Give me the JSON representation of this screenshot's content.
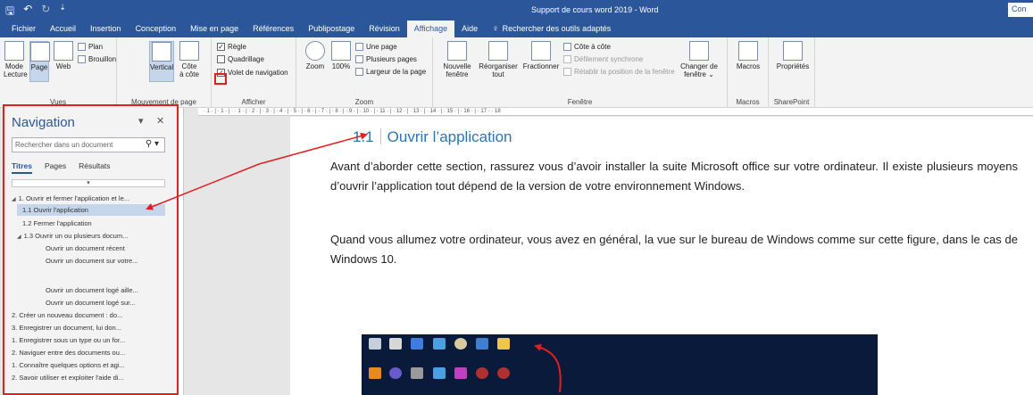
{
  "titlebar": {
    "doc_title": "Support de cours word 2019  -  Word",
    "account_btn": "Con"
  },
  "tabs": [
    "Fichier",
    "Accueil",
    "Insertion",
    "Conception",
    "Mise en page",
    "Références",
    "Publipostage",
    "Révision",
    "Affichage",
    "Aide"
  ],
  "tell_me": "Rechercher des outils adaptés",
  "ribbon": {
    "vues": {
      "label": "Vues",
      "mode_lecture": "Mode\nLecture",
      "page": "Page",
      "web": "Web",
      "plan": "Plan",
      "brouillon": "Brouillon"
    },
    "mouvement": {
      "label": "Mouvement de page",
      "vertical": "Vertical",
      "cote": "Côte\nà côte"
    },
    "afficher": {
      "label": "Afficher",
      "regle": "Règle",
      "quadrillage": "Quadrillage",
      "volet": "Volet de navigation",
      "regle_checked": "✓",
      "volet_checked": "✓"
    },
    "zoom": {
      "label": "Zoom",
      "zoom": "Zoom",
      "pct": "100%",
      "une_page": "Une page",
      "plusieurs": "Plusieurs pages",
      "largeur": "Largeur de la page"
    },
    "fenetre": {
      "label": "Fenêtre",
      "nouvelle": "Nouvelle\nfenêtre",
      "reorganiser": "Réorganiser\ntout",
      "fractionner": "Fractionner",
      "cote_a_cote": "Côte à côte",
      "defilement": "Défilement synchrone",
      "retablir": "Rétablir la position de la fenêtre",
      "changer": "Changer de\nfenêtre ⌄"
    },
    "macros": {
      "label": "Macros",
      "btn": "Macros"
    },
    "sharepoint": {
      "label": "SharePoint",
      "btn": "Propriétés"
    }
  },
  "navigation": {
    "title": "Navigation",
    "search_placeholder": "Rechercher dans un document",
    "tabs": [
      "Titres",
      "Pages",
      "Résultats"
    ],
    "items": [
      "1. Ouvrir et fermer l'application et le...",
      "1.1  Ouvrir l'application",
      "1.2 Fermer l'application",
      "1.3 Ouvrir un ou plusieurs docum...",
      "Ouvrir un document récent",
      "Ouvrir un document sur votre...",
      "Ouvrir un document logé aille...",
      "Ouvrir un document logé sur...",
      "2. Créer un nouveau document : do...",
      "3. Enregistrer un document, lui don...",
      "1. Enregistrer sous un type ou un for...",
      "2. Naviguer entre des documents ou...",
      "1. Connaître quelques options et agi...",
      "2. Savoir utiliser et exploiter l'aide di..."
    ]
  },
  "ruler_text": "· 1 · | · 1 · | ·   · 1 · | · 2 · | · 3 · | · 4 · | · 5 · | · 6 · | · 7 · | · 8 · | · 9 · | · 10 · | · 11 · | · 12 · | · 13 · | · 14 · | · 15 · | · 16 · | · 17 ·   · 18",
  "document": {
    "heading_num": "1.1",
    "heading_text": "Ouvrir l’application",
    "para1": "Avant d’aborder cette section, rassurez vous d’avoir installer la suite Microsoft office sur votre ordinateur.  Il existe plusieurs moyens d’ouvrir l’application tout dépend de la version de votre environnement Windows.",
    "para2": "Quand vous allumez votre ordinateur, vous avez en général, la vue sur le bureau de Windows comme sur cette figure, dans le cas de Windows 10."
  },
  "colors": {
    "accent": "#2b579a",
    "heading": "#2e74b5",
    "annotation": "#e02020"
  }
}
